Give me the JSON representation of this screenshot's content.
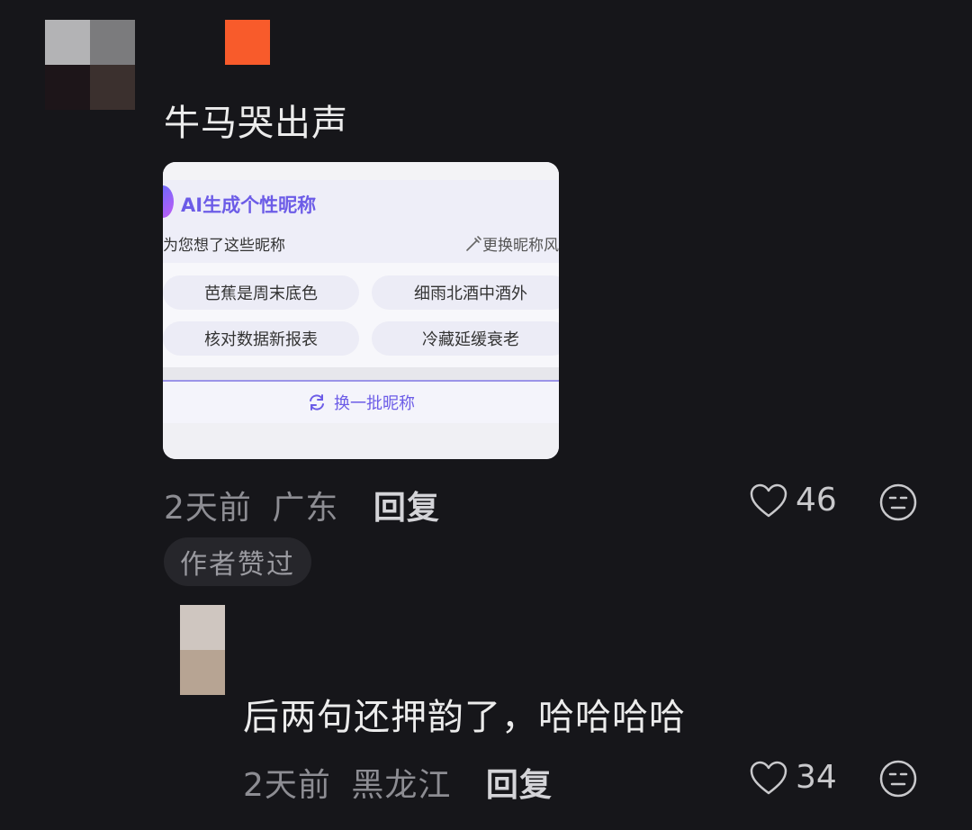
{
  "comment": {
    "text": "牛马哭出声",
    "time": "2天前",
    "location": "广东",
    "reply_label": "回复",
    "likes": "46",
    "author_liked_badge": "作者赞过"
  },
  "embedded_card": {
    "title": "AI生成个性昵称",
    "subtitle": "为您想了这些昵称",
    "change_style": "更换昵称风",
    "nicknames": [
      "芭蕉是周末底色",
      "细雨北酒中酒外",
      "核对数据新报表",
      "冷藏延缓衰老"
    ],
    "refresh_label": "换一批昵称",
    "accent_color": "#6c5ce7"
  },
  "reply": {
    "text": "后两句还押韵了，哈哈哈哈",
    "time": "2天前",
    "location": "黑龙江",
    "reply_label": "回复",
    "likes": "34"
  },
  "icons": [
    "heart-icon",
    "dislike-face-icon",
    "refresh-icon",
    "magic-wand-icon"
  ],
  "colors": {
    "background": "#16161a",
    "text": "#ececec",
    "meta": "#8d8d93",
    "orange_badge": "#f85b2b"
  }
}
